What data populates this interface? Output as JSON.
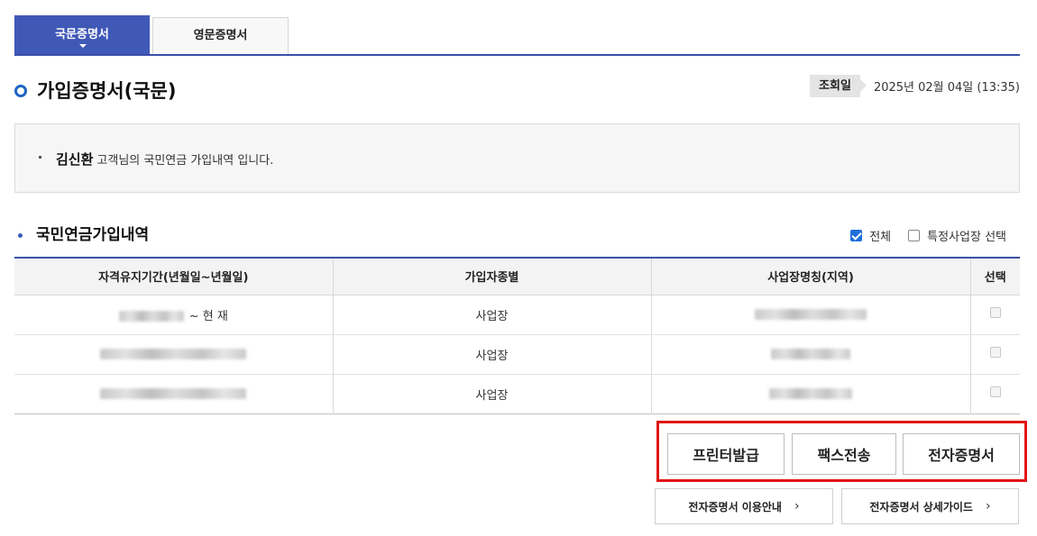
{
  "tabs": [
    {
      "label": "국문증명서",
      "active": true
    },
    {
      "label": "영문증명서",
      "active": false
    }
  ],
  "page": {
    "title": "가입증명서(국문)"
  },
  "lookup": {
    "label": "조회일",
    "date": "2025년 02월 04일 (13:35)"
  },
  "info": {
    "name": "김신환",
    "text": "고객님의 국민연금 가입내역 입니다."
  },
  "section": {
    "title": "국민연금가입내역"
  },
  "filters": {
    "all_label": "전체",
    "all_checked": true,
    "specific_label": "특정사업장 선택",
    "specific_checked": false
  },
  "table": {
    "headers": [
      "자격유지기간(년월일~년월일)",
      "가입자종별",
      "사업장명칭(지역)",
      "선택"
    ],
    "rows": [
      {
        "period_suffix": "~ 현 재",
        "type": "사업장"
      },
      {
        "period_suffix": "",
        "type": "사업장"
      },
      {
        "period_suffix": "",
        "type": "사업장"
      }
    ]
  },
  "actions": {
    "print": "프린터발급",
    "fax": "팩스전송",
    "ecert": "전자증명서"
  },
  "guides": {
    "usage": "전자증명서 이용안내",
    "detail": "전자증명서 상세가이드"
  },
  "colors": {
    "accent": "#4058b6",
    "highlight": "#e01515",
    "checkbox": "#1f6fd9"
  }
}
